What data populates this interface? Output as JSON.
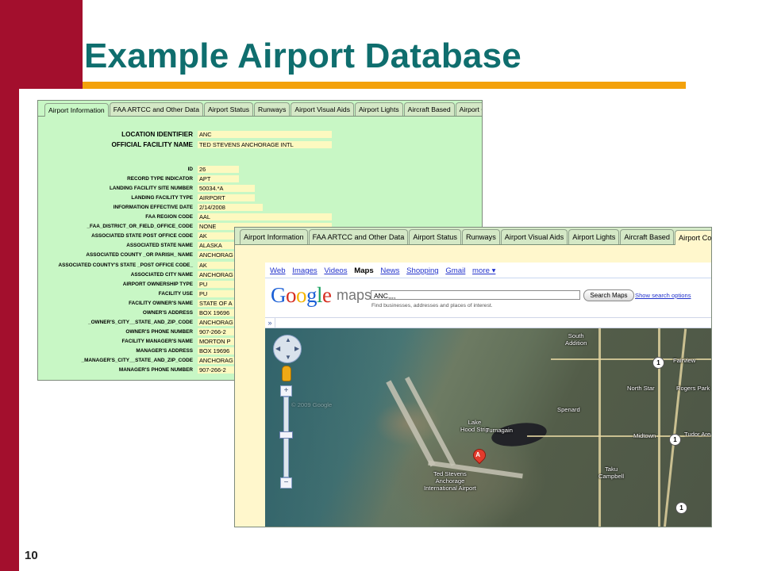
{
  "slide": {
    "title": "Example Airport Database",
    "number": "10",
    "colors": {
      "red_bar": "#a30f2d",
      "title": "#0f6e6e",
      "rule": "#f3a10b"
    }
  },
  "tabs": [
    "Airport Information",
    "FAA ARTCC and Other Data",
    "Airport Status",
    "Runways",
    "Airport Visual Aids",
    "Airport Lights",
    "Aircraft Based",
    "Airport Coordinates"
  ],
  "form": {
    "location_identifier": {
      "label": "LOCATION IDENTIFIER",
      "value": "ANC"
    },
    "official_facility_name": {
      "label": "OFFICIAL FACILITY NAME",
      "value": "TED STEVENS ANCHORAGE INTL"
    },
    "fields": [
      {
        "label": "ID",
        "value": "26"
      },
      {
        "label": "RECORD TYPE INDICATOR",
        "value": "APT"
      },
      {
        "label": "LANDING FACILITY SITE NUMBER",
        "value": "50034.*A"
      },
      {
        "label": "LANDING FACILITY TYPE",
        "value": "AIRPORT"
      },
      {
        "label": "INFORMATION EFFECTIVE DATE",
        "value": "2/14/2008"
      },
      {
        "label": "FAA REGION CODE",
        "value": "AAL"
      },
      {
        "label": "_FAA_DISTRICT_OR_FIELD_OFFICE_CODE",
        "value": "NONE"
      },
      {
        "label": "ASSOCIATED STATE POST OFFICE CODE",
        "value": "AK"
      },
      {
        "label": "ASSOCIATED STATE NAME",
        "value": "ALASKA"
      },
      {
        "label": "ASSOCIATED COUNTY _OR PARISH_ NAME",
        "value": "ANCHORAG"
      },
      {
        "label": "ASSOCIATED COUNTY'S STATE _POST OFFICE CODE_",
        "value": "AK"
      },
      {
        "label": "ASSOCIATED CITY NAME",
        "value": "ANCHORAG"
      },
      {
        "label": "AIRPORT OWNERSHIP TYPE",
        "value": "PU"
      },
      {
        "label": "FACILITY USE",
        "value": "PU"
      },
      {
        "label": "FACILITY OWNER'S NAME",
        "value": "STATE OF A"
      },
      {
        "label": "OWNER'S ADDRESS",
        "value": "BOX 19696"
      },
      {
        "label": "_OWNER'S_CITY__STATE_AND_ZIP_CODE",
        "value": "ANCHORAG"
      },
      {
        "label": "OWNER'S PHONE NUMBER",
        "value": "907-266-2"
      },
      {
        "label": "FACILITY MANAGER'S NAME",
        "value": "MORTON P"
      },
      {
        "label": "MANAGER'S ADDRESS",
        "value": "BOX 19696"
      },
      {
        "label": "_MANAGER'S_CITY__STATE_AND_ZIP_CODE",
        "value": "ANCHORAG"
      },
      {
        "label": "MANAGER'S PHONE NUMBER",
        "value": "907-266-2"
      }
    ]
  },
  "google": {
    "nav": {
      "web": "Web",
      "images": "Images",
      "videos": "Videos",
      "maps": "Maps",
      "news": "News",
      "shopping": "Shopping",
      "gmail": "Gmail",
      "more": "more ▾"
    },
    "logo": "Google",
    "logo_suffix": "maps",
    "search_value": "ANC,,,,",
    "search_hint": "Find businesses, addresses and places of interest.",
    "search_button": "Search Maps",
    "options_link": "Show search options",
    "collapse_glyph": "»"
  },
  "map": {
    "labels": {
      "south_addition": "South\nAddition",
      "fairview": "Fairview",
      "north_star": "North Star",
      "rogers_park": "Rogers Park",
      "spenard": "Spenard",
      "lake_hood": "Lake\nHood Strip",
      "turnagain": "Turnagain",
      "midtown": "Midtown",
      "tudor_area": "Tudor Area",
      "taku_campbell": "Taku\nCampbell",
      "airport": "Ted Stevens\nAnchorage\nInternational Airport",
      "watermark": "© 2009 Google"
    },
    "marker_letter": "A",
    "route_shield": "1"
  }
}
